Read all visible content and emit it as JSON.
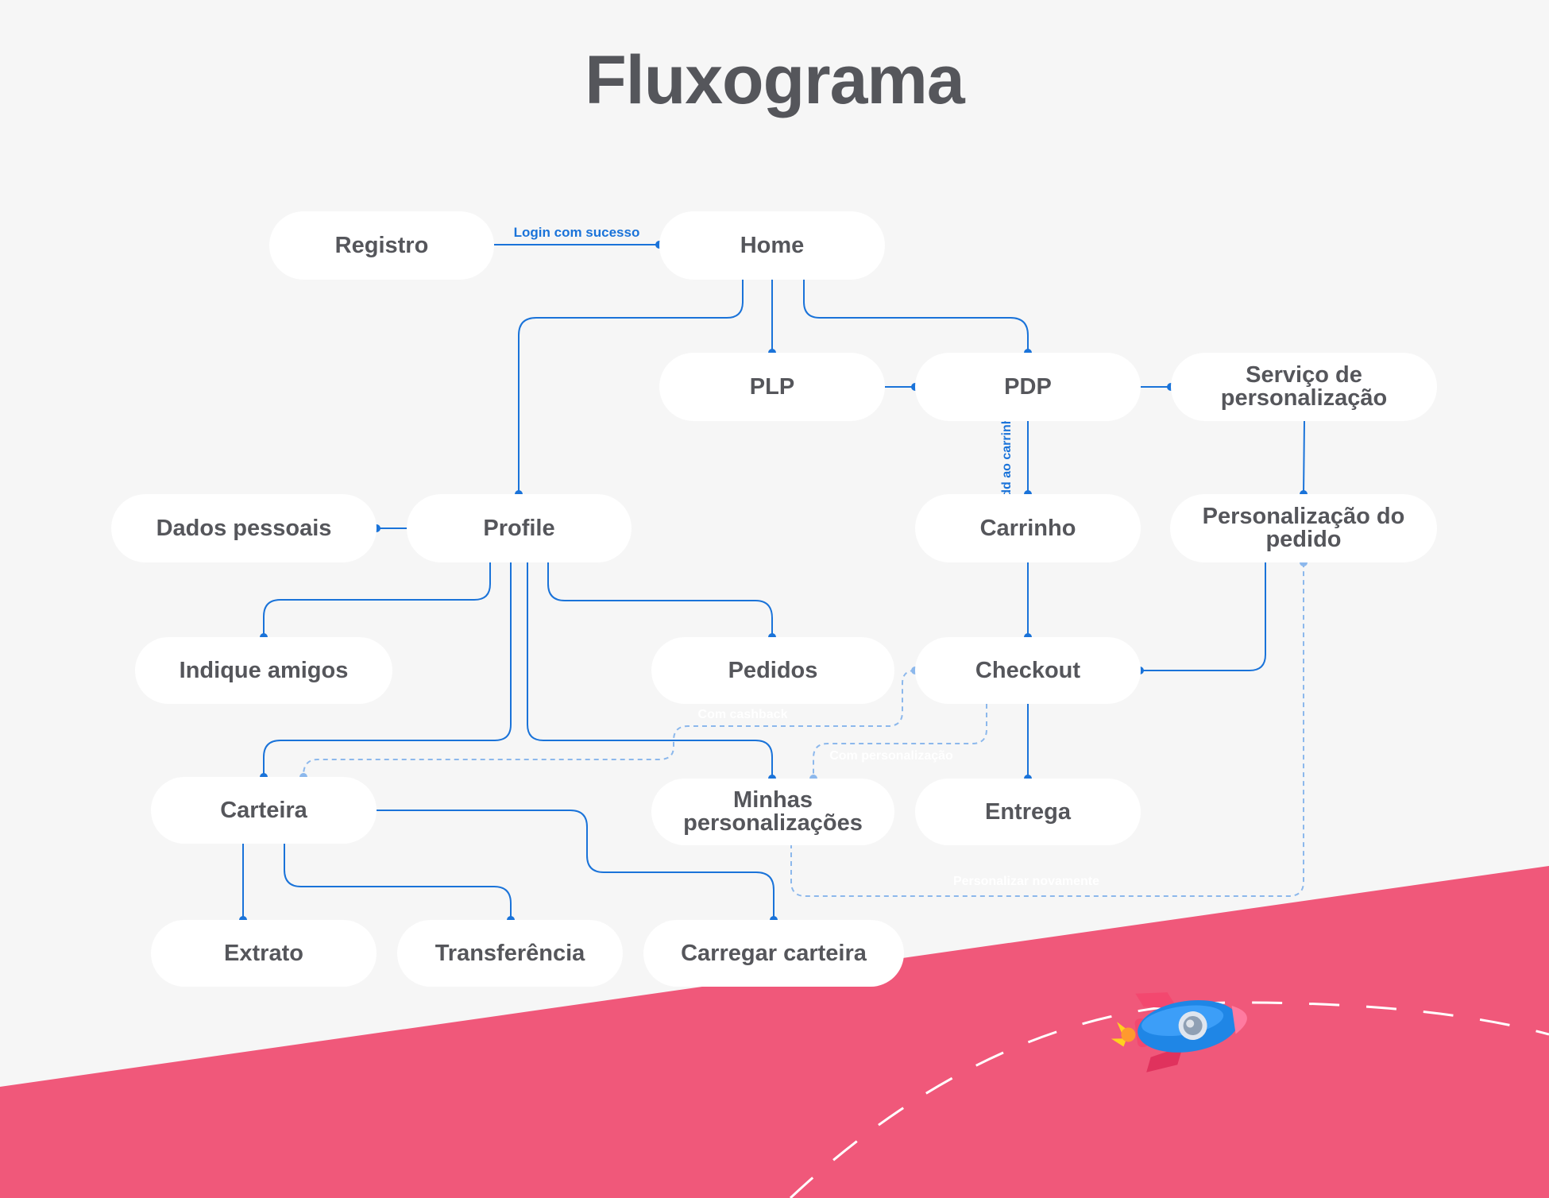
{
  "title": "Fluxograma",
  "colors": {
    "background": "#f6f6f6",
    "accent_band": "#f0587a",
    "node_fill": "#ffffff",
    "node_text": "#55565b",
    "connector": "#1a73d9",
    "dashed_connector": "#8cb8ec"
  },
  "nodes": {
    "registro": "Registro",
    "home": "Home",
    "plp": "PLP",
    "pdp": "PDP",
    "servico": "Serviço de personalização",
    "dados": "Dados pessoais",
    "profile": "Profile",
    "carrinho": "Carrinho",
    "personalizacao_pedido": "Personalização do pedido",
    "indique": "Indique amigos",
    "pedidos": "Pedidos",
    "checkout": "Checkout",
    "carteira": "Carteira",
    "minhas": "Minhas personalizações",
    "entrega": "Entrega",
    "extrato": "Extrato",
    "transferencia": "Transferência",
    "carregar": "Carregar carteira"
  },
  "edge_labels": {
    "login": "Login com sucesso",
    "add_carrinho": "Add ao carrinho",
    "cashback": "Com cashback",
    "personalizacao": "Com personalização",
    "personalizar_novamente": "Personalizar novamente"
  },
  "decoration": {
    "rocket": "rocket-icon"
  }
}
